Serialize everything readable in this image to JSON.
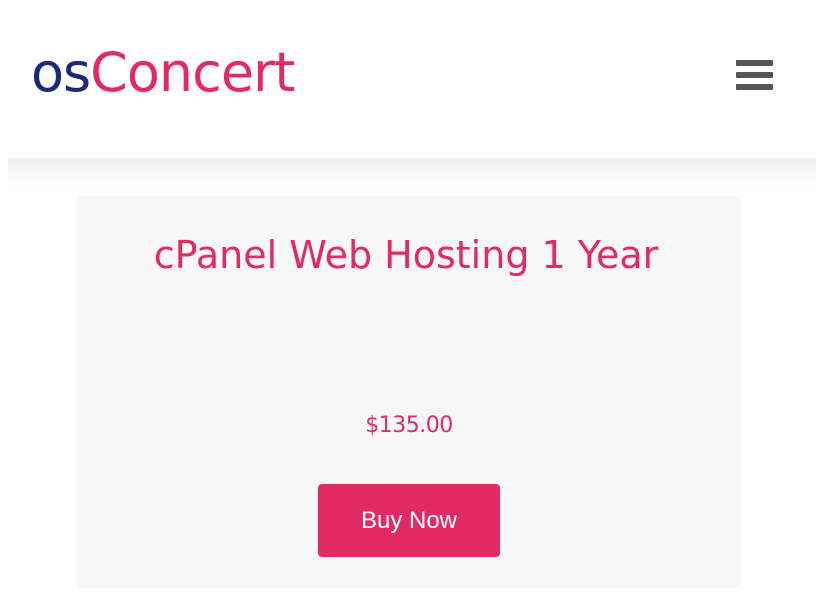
{
  "header": {
    "logo_part1": "os",
    "logo_part2": "Concert",
    "menu_icon": "hamburger-menu-icon"
  },
  "product": {
    "title": "cPanel Web Hosting 1 Year",
    "price": "$135.00",
    "buy_label": "Buy Now"
  },
  "colors": {
    "brand_pink": "#e42a64",
    "brand_navy": "#1a2a7a",
    "menu_gray": "#555555",
    "card_background": "#f7f7f7",
    "button_background": "#e22a64",
    "button_text": "#ffffff"
  }
}
